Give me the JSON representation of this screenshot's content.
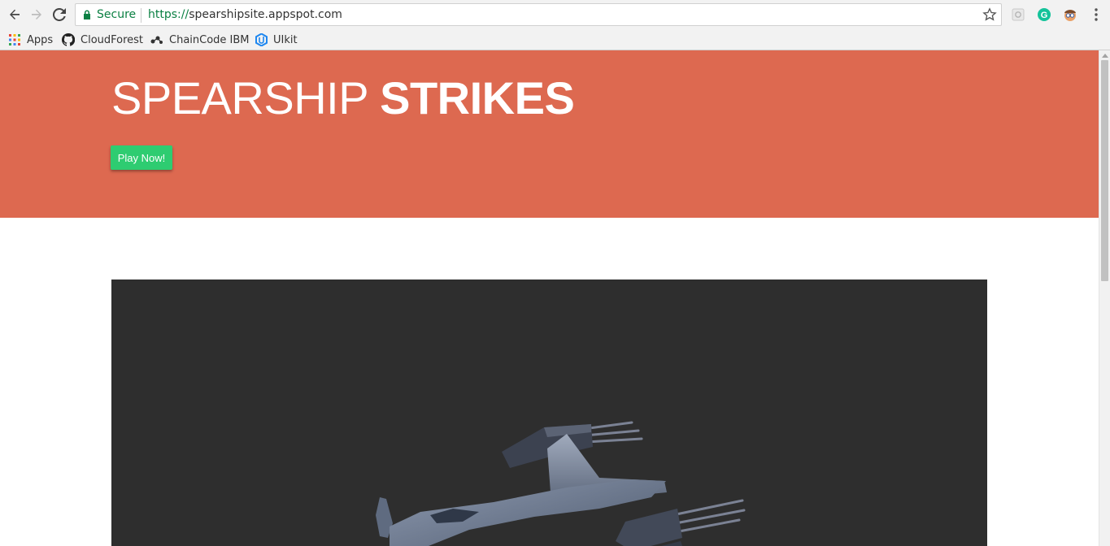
{
  "browser": {
    "secure_label": "Secure",
    "url_scheme": "https://",
    "url_host": "spearshipsite.appspot.com",
    "bookmarks": [
      {
        "label": "Apps",
        "icon": "apps-grid-icon"
      },
      {
        "label": "CloudForest",
        "icon": "github-icon"
      },
      {
        "label": "ChainCode IBM",
        "icon": "chaincode-icon"
      },
      {
        "label": "UIkit",
        "icon": "uikit-icon"
      }
    ],
    "extensions": [
      "settings-extension-icon",
      "grammarly-icon",
      "avatar-extension-icon"
    ],
    "colors": {
      "secure": "#0b8043",
      "chrome_bg": "#f2f2f2"
    }
  },
  "page": {
    "hero": {
      "title_light": "SPEARSHIP ",
      "title_bold": "STRIKES",
      "play_button": "Play Now!",
      "bg_color": "#dd6950",
      "button_color": "#2ecc71"
    },
    "game": {
      "bg_color": "#2e2e2e",
      "content": "spaceship-3d-model"
    }
  }
}
